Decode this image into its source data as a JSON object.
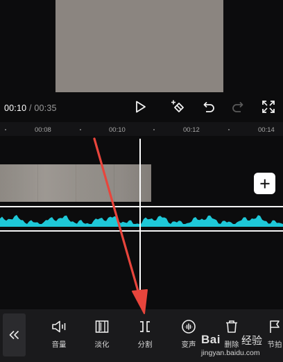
{
  "preview": {
    "time_current": "00:10",
    "time_separator": "/",
    "time_total": "00:35"
  },
  "controls": {
    "play_icon": "play-icon",
    "keyframe_icon": "keyframe-add-icon",
    "undo_icon": "undo-icon",
    "redo_icon": "redo-icon",
    "fullscreen_icon": "fullscreen-icon"
  },
  "ruler": {
    "ticks": [
      "00:08",
      "00:10",
      "00:12",
      "00:14"
    ]
  },
  "timeline": {
    "add_clip_icon": "plus-icon"
  },
  "toolbar": {
    "collapse_icon": "double-chevron-left-icon",
    "tools": [
      {
        "label": "音量",
        "icon": "volume-icon"
      },
      {
        "label": "淡化",
        "icon": "fade-icon"
      },
      {
        "label": "分割",
        "icon": "split-icon"
      },
      {
        "label": "变声",
        "icon": "voice-change-icon"
      },
      {
        "label": "删除",
        "icon": "delete-icon"
      },
      {
        "label": "节拍",
        "icon": "beat-flag-icon"
      }
    ]
  },
  "watermark": {
    "logo": "Bai",
    "text": "经验",
    "url": "jingyan.baidu.com"
  },
  "colors": {
    "background": "#0c0c0d",
    "waveform": "#1ec8d8",
    "annotation_arrow": "#e8453c",
    "toolbar": "#1a1a1c"
  }
}
